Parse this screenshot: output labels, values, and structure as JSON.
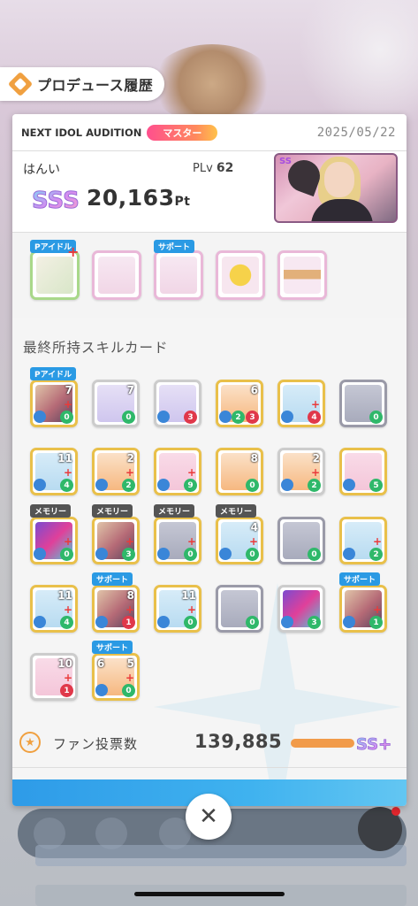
{
  "header": {
    "title": "プロデュース履歴",
    "icon": "produce-history-icon"
  },
  "audition": {
    "name": "NEXT IDOL AUDITION",
    "rank": "マスター",
    "date": "2025/05/22"
  },
  "player": {
    "name": "はんい",
    "plv_label": "PLv",
    "plv_value": "62",
    "score_rank": "SSS",
    "score": "20,163",
    "score_unit": "Pt",
    "thumb_rank": "SS"
  },
  "items": {
    "tags": {
      "pidol": "Pアイドル",
      "support": "サポート"
    },
    "list": [
      {
        "name": "item-1",
        "icon": "music-sheet-icon"
      },
      {
        "name": "item-2",
        "icon": "paper-bag-icon"
      },
      {
        "name": "item-3",
        "icon": "book-icon"
      },
      {
        "name": "item-4",
        "icon": "badge-icon"
      },
      {
        "name": "item-5",
        "icon": "bracelet-icon"
      }
    ]
  },
  "skills": {
    "title": "最終所持スキルカード",
    "tags": {
      "pidol": "Pアイドル",
      "memory": "メモリー",
      "support": "サポート"
    },
    "cards": [
      {
        "lv": "7",
        "cost": "0"
      },
      {
        "lv": "7",
        "cost": "0"
      },
      {
        "lv": "",
        "cost": "3"
      },
      {
        "lv": "6",
        "cost": "2",
        "cost2": "3"
      },
      {
        "lv": "",
        "cost": "4"
      },
      {
        "lv": "",
        "cost": "0"
      },
      {
        "lv": "11",
        "cost": "4"
      },
      {
        "lv": "2",
        "cost": "2"
      },
      {
        "lv": "",
        "cost": "9"
      },
      {
        "lv": "8",
        "cost": "0"
      },
      {
        "lv": "2",
        "cost": "2"
      },
      {
        "lv": "",
        "cost": "5"
      },
      {
        "lv": "",
        "cost": "0",
        "lvl2": "1"
      },
      {
        "lv": "",
        "cost": "3",
        "lvl2": "1"
      },
      {
        "lv": "",
        "cost": "0",
        "lvl2": "1"
      },
      {
        "lv": "4",
        "cost": "0",
        "lvl2": "1"
      },
      {
        "lv": "",
        "cost": "0"
      },
      {
        "lv": "",
        "cost": "2"
      },
      {
        "lv": "11",
        "cost": "4"
      },
      {
        "lv": "8",
        "cost": "1"
      },
      {
        "lv": "11",
        "cost": "0"
      },
      {
        "lv": "",
        "cost": "0"
      },
      {
        "lv": "",
        "cost": "3"
      },
      {
        "lv": "",
        "cost": "1"
      },
      {
        "lv": "10",
        "cost": "1"
      },
      {
        "lv": "5",
        "cost": "0",
        "lv_left": "6"
      }
    ]
  },
  "fan": {
    "label": "ファン投票数",
    "value": "139,885",
    "rank": "SS+"
  },
  "close": {
    "label": "✕"
  }
}
